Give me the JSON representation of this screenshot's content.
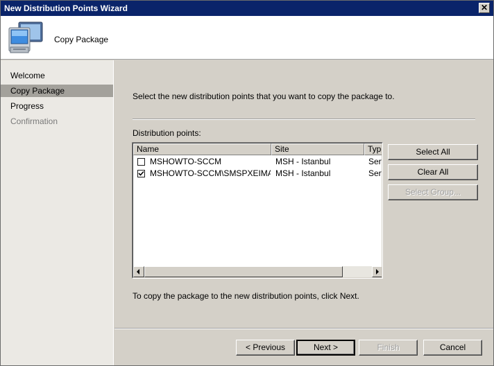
{
  "window": {
    "title": "New Distribution Points Wizard",
    "close_label": "✕"
  },
  "header": {
    "title": "Copy Package",
    "icon": "computer-monitor-icon"
  },
  "nav": {
    "items": [
      {
        "label": "Welcome",
        "state": "normal"
      },
      {
        "label": "Copy Package",
        "state": "selected"
      },
      {
        "label": "Progress",
        "state": "normal"
      },
      {
        "label": "Confirmation",
        "state": "disabled"
      }
    ]
  },
  "main": {
    "instruction": "Select the new distribution points that you want to copy the package to.",
    "list_label": "Distribution points:",
    "columns": [
      "Name",
      "Site",
      "Type"
    ],
    "rows": [
      {
        "checked": false,
        "name": "MSHOWTO-SCCM",
        "site": "MSH - Istanbul",
        "type": "Serv"
      },
      {
        "checked": true,
        "name": "MSHOWTO-SCCM\\SMSPXEIMAGES$",
        "site": "MSH - Istanbul",
        "type": "Serv"
      }
    ],
    "select_all_label": "Select All",
    "clear_all_label": "Clear All",
    "select_group_label": "Select Group...",
    "hint": "To copy the package to the new distribution points, click Next."
  },
  "footer": {
    "previous_label": "< Previous",
    "next_label": "Next >",
    "finish_label": "Finish",
    "cancel_label": "Cancel"
  }
}
